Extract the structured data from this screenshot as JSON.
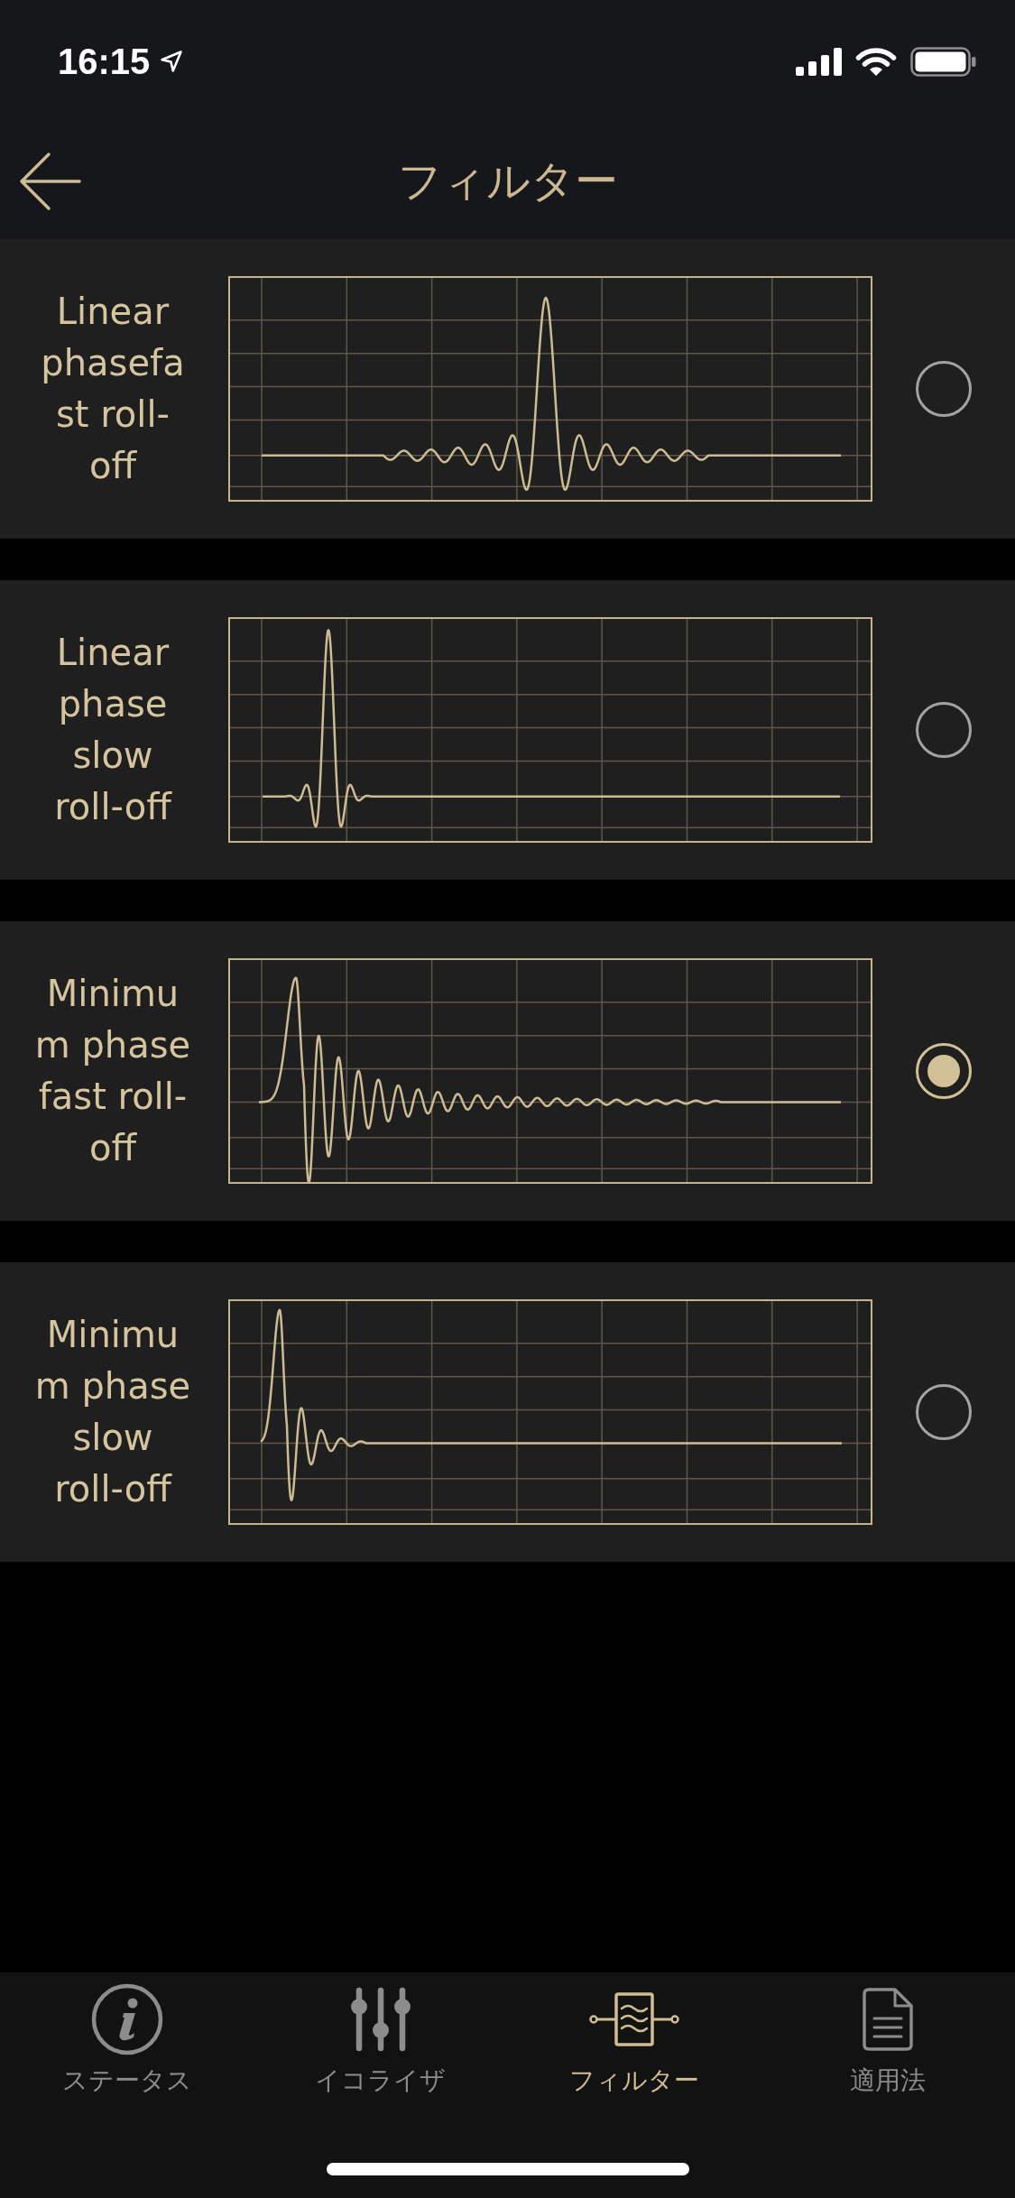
{
  "status_bar": {
    "time": "16:15"
  },
  "header": {
    "title": "フィルター"
  },
  "filters": [
    {
      "label": "Linear phasefast roll-off",
      "kind": "linear_fast",
      "selected": false
    },
    {
      "label": "Linear phase slow roll-off",
      "kind": "linear_slow",
      "selected": false
    },
    {
      "label": "Minimum phase fast roll-off",
      "kind": "minimum_fast",
      "selected": true
    },
    {
      "label": "Minimum phase slow roll-off",
      "kind": "minimum_slow",
      "selected": false
    }
  ],
  "tab_bar": [
    {
      "label": "ステータス",
      "selected": false
    },
    {
      "label": "イコライザ",
      "selected": false
    },
    {
      "label": "フィルター",
      "selected": true
    },
    {
      "label": "適用法",
      "selected": false
    }
  ]
}
